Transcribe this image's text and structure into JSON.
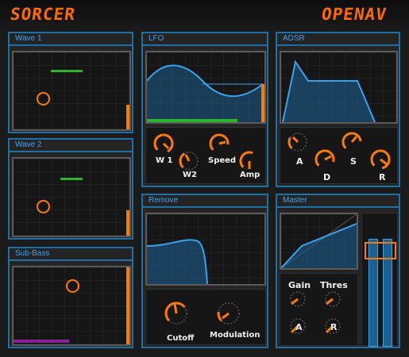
{
  "header": {
    "left_logo": "SORCER",
    "right_logo": "OPENAV"
  },
  "colors": {
    "accent": "#ff7a00",
    "frame": "#1f70a6",
    "title": "#3aa3f0",
    "green": "#2cb52c",
    "purple": "#8a1f9a",
    "fill": "#1d5f8e"
  },
  "panels": {
    "wave1": {
      "title": "Wave 1",
      "level": 0.22
    },
    "wave2": {
      "title": "Wave 2",
      "level": 0.33
    },
    "subbass": {
      "title": "Sub-Bass",
      "level": 1.0
    },
    "lfo": {
      "title": "LFO",
      "knobs": [
        "W 1",
        "W2",
        "Speed",
        "Amp"
      ]
    },
    "adsr": {
      "title": "ADSR",
      "knobs": [
        "A",
        "D",
        "S",
        "R"
      ]
    },
    "remove": {
      "title": "Remove",
      "knobs": [
        "Cutoff",
        "Modulation"
      ]
    },
    "master": {
      "title": "Master",
      "knobs": [
        "Gain",
        "Thres",
        "A",
        "R"
      ]
    }
  }
}
